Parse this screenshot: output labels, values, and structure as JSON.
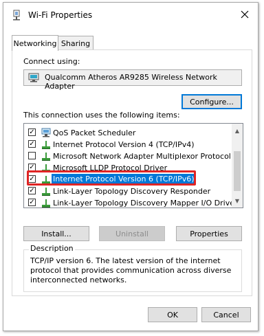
{
  "window": {
    "title": "Wi-Fi Properties"
  },
  "tabs": [
    {
      "label": "Networking"
    },
    {
      "label": "Sharing"
    }
  ],
  "connect_using": {
    "label": "Connect using:",
    "adapter": "Qualcomm Atheros AR9285 Wireless Network Adapter"
  },
  "configure_label": "Configure...",
  "items_label": "This connection uses the following items:",
  "items": [
    {
      "label": "QoS Packet Scheduler",
      "checked": true,
      "icon": "qos-icon"
    },
    {
      "label": "Internet Protocol Version 4 (TCP/IPv4)",
      "checked": true,
      "icon": "protocol-icon"
    },
    {
      "label": "Microsoft Network Adapter Multiplexor Protocol",
      "checked": false,
      "icon": "protocol-icon"
    },
    {
      "label": "Microsoft LLDP Protocol Driver",
      "checked": true,
      "icon": "protocol-icon"
    },
    {
      "label": "Internet Protocol Version 6 (TCP/IPv6)",
      "checked": true,
      "icon": "protocol-icon",
      "selected": true
    },
    {
      "label": "Link-Layer Topology Discovery Responder",
      "checked": true,
      "icon": "protocol-icon"
    },
    {
      "label": "Link-Layer Topology Discovery Mapper I/O Driver",
      "checked": true,
      "icon": "protocol-icon"
    }
  ],
  "buttons": {
    "install": "Install...",
    "uninstall": "Uninstall",
    "properties": "Properties",
    "ok": "OK",
    "cancel": "Cancel"
  },
  "description": {
    "label": "Description",
    "text": "TCP/IP version 6. The latest version of the internet protocol that provides communication across diverse interconnected networks."
  },
  "colors": {
    "selection": "#0078d7",
    "highlight_box": "#e02424",
    "default_button_border": "#0078d7"
  }
}
